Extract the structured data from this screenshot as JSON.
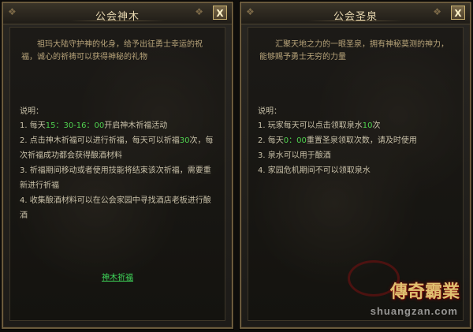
{
  "left_panel": {
    "title": "公会神木",
    "close_label": "X",
    "intro": "祖玛大陆守护神的化身，给予出征勇士幸运的祝福，诚心的祈祷可以获得神秘的礼物",
    "desc_label": "说明：",
    "rules": [
      {
        "pre": "1. 每天",
        "hl": "15：30-16：00",
        "post": "开启神木祈福活动"
      },
      {
        "pre": "2. 点击神木祈福可以进行祈福，每天可以祈福",
        "hl": "30",
        "post": "次，每次祈福成功都会获得酿酒材料"
      },
      {
        "pre": "3. 祈福期间移动或者使用技能将结束该次祈福，需要重新进行祈福",
        "hl": "",
        "post": ""
      },
      {
        "pre": "4. 收集酿酒材料可以在公会家园中寻找酒店老板进行酿酒",
        "hl": "",
        "post": ""
      }
    ],
    "link": "神木祈福"
  },
  "right_panel": {
    "title": "公会圣泉",
    "close_label": "X",
    "intro": "汇聚天地之力的一眼圣泉，拥有神秘莫测的神力，能够赐予勇士无穷的力量",
    "desc_label": "说明：",
    "rules": [
      {
        "pre": "1. 玩家每天可以点击领取泉水",
        "hl": "10",
        "post": "次"
      },
      {
        "pre": "2. 每天",
        "hl": "0：00",
        "post": "重置圣泉领取次数，请及时使用"
      },
      {
        "pre": "3. 泉水可以用于酿酒",
        "hl": "",
        "post": ""
      },
      {
        "pre": "4. 家园危机期间不可以领取泉水",
        "hl": "",
        "post": ""
      }
    ],
    "logo": "傳奇霸業",
    "watermark": "shuangzan.com"
  },
  "colors": {
    "highlight": "#4fd04f",
    "link": "#3fd85a",
    "title": "#e8d8b0",
    "intro": "#b8a47a"
  }
}
